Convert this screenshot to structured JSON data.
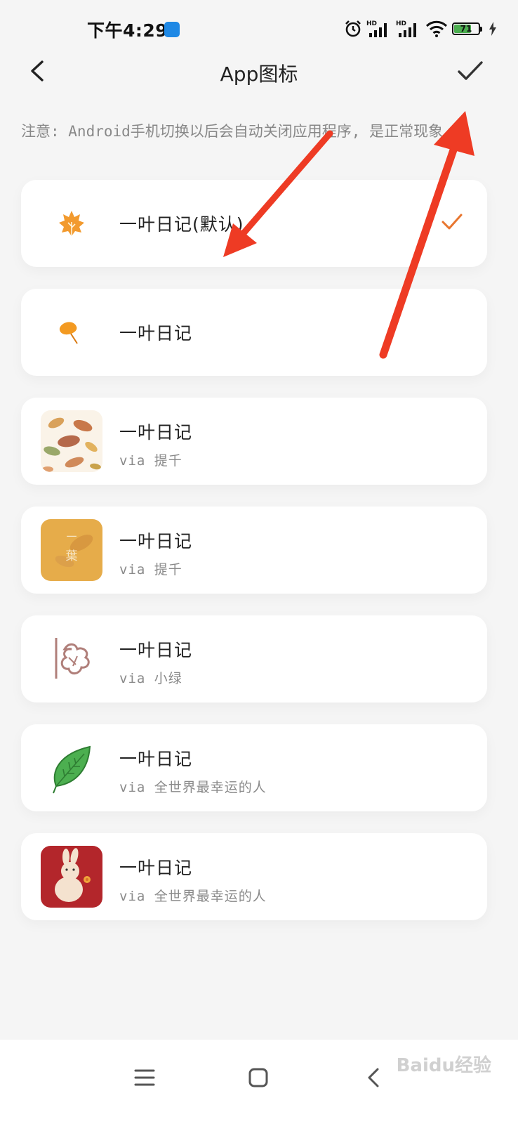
{
  "status_bar": {
    "time": "下午4:29",
    "network_labels": [
      "HD",
      "HD"
    ],
    "battery_level": "71",
    "battery_fraction": 0.71
  },
  "header": {
    "title": "App图标",
    "back_icon": "chevron-left-icon",
    "confirm_icon": "check-icon"
  },
  "notice": "注意: Android手机切换以后会自动关闭应用程序, 是正常现象",
  "icon_options": [
    {
      "title": "一叶日记(默认)",
      "subtitle": "",
      "icon": "maple-leaf-icon",
      "selected": true
    },
    {
      "title": "一叶日记",
      "subtitle": "",
      "icon": "ginkgo-leaf-icon",
      "selected": false
    },
    {
      "title": "一叶日记",
      "subtitle": "via 提千",
      "icon": "autumn-leaves-pattern-icon",
      "selected": false
    },
    {
      "title": "一叶日记",
      "subtitle": "via 提千",
      "icon": "yellow-square-leaf-icon",
      "icon_text": "一 葉",
      "selected": false
    },
    {
      "title": "一叶日记",
      "subtitle": "via 小绿",
      "icon": "sketch-flower-icon",
      "selected": false
    },
    {
      "title": "一叶日记",
      "subtitle": "via 全世界最幸运的人",
      "icon": "green-leaf-icon",
      "selected": false
    },
    {
      "title": "一叶日记",
      "subtitle": "via 全世界最幸运的人",
      "icon": "rabbit-icon",
      "selected": false
    }
  ],
  "nav_bar": {
    "menu_icon": "menu-icon",
    "home_icon": "home-icon",
    "back_icon": "back-icon"
  },
  "watermark": "Baidu经验",
  "colors": {
    "accent_check": "#e8762f",
    "annotation_arrow": "#ee3b24",
    "background": "#f5f5f5",
    "card": "#ffffff"
  }
}
